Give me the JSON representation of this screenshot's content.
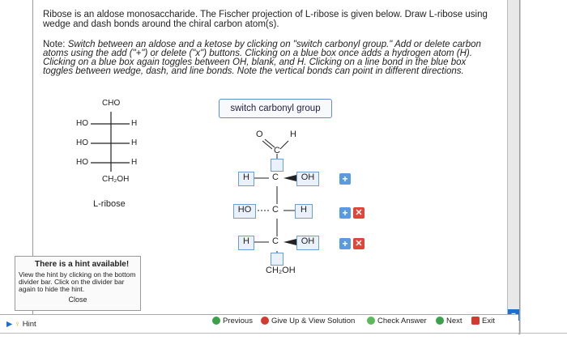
{
  "prompt": "Ribose is an aldose monosaccharide. The Fischer projection of L-ribose is given below. Draw L-ribose using wedge and dash bonds around the chiral carbon atom(s).",
  "note_title": "Note:",
  "note_body": "Switch between an aldose and a ketose by clicking on \"switch carbonyl group.\" Add or delete carbon atoms using the add (\"+\") or delete (\"x\") buttons. Clicking on a blue box once adds a hydrogen atom (H). Clicking on a blue box again toggles between OH, blank, and H. Clicking on a line bond in the blue box toggles between wedge, dash, and line bonds. Note the vertical bonds can point in different directions.",
  "fischer": {
    "top": "CHO",
    "rows": [
      {
        "left": "HO",
        "right": "H"
      },
      {
        "left": "HO",
        "right": "H"
      },
      {
        "left": "HO",
        "right": "H"
      }
    ],
    "bottom": "CH₂OH",
    "name": "L-ribose"
  },
  "switch_button": "switch carbonyl group",
  "molecule": {
    "carbonyl_o": "O",
    "carbonyl_h": "H",
    "carbonyl_c": "C",
    "rows": [
      {
        "left": "H",
        "center": "C",
        "right": "OH"
      },
      {
        "left": "HO",
        "center": "C",
        "right": "H"
      },
      {
        "left": "H",
        "center": "C",
        "right": "OH"
      }
    ],
    "bottom": "CH₂OH"
  },
  "hint": {
    "title": "There is a hint available!",
    "body": "View the hint by clicking on the bottom divider bar. Click on the divider bar again to hide the hint.",
    "close": "Close"
  },
  "footer": {
    "hint": "Hint",
    "previous": "Previous",
    "give_up": "Give Up & View Solution",
    "check": "Check Answer",
    "next": "Next",
    "exit": "Exit"
  }
}
